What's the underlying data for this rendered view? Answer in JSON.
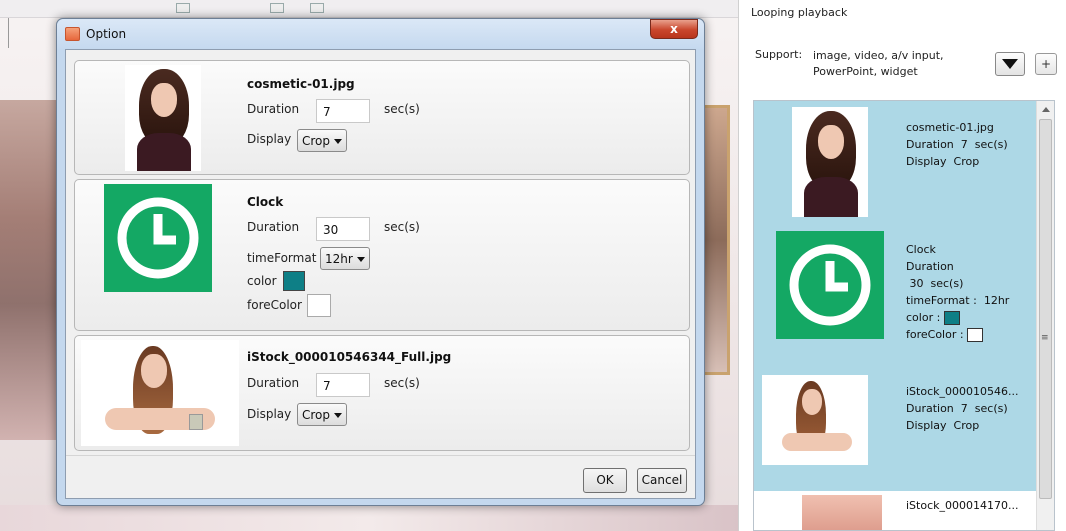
{
  "background": {
    "right_panel": {
      "title": "Looping playback",
      "support_label": "Support:",
      "support_value": "image, video, a/v input, PowerPoint, widget",
      "add_label": "+",
      "items": [
        {
          "name": "cosmetic-01.jpg",
          "duration_label": "Duration",
          "duration": "7",
          "unit": "sec(s)",
          "display_label": "Display",
          "display": "Crop"
        },
        {
          "name": "Clock",
          "duration_label": "Duration",
          "duration": "30",
          "unit": "sec(s)",
          "timeformat_label": "timeFormat :",
          "timeformat": "12hr",
          "color_label": "color :",
          "forecolor_label": "foreColor :"
        },
        {
          "name": "iStock_000010546...",
          "duration_label": "Duration",
          "duration": "7",
          "unit": "sec(s)",
          "display_label": "Display",
          "display": "Crop"
        },
        {
          "name": "iStock_000014170..."
        }
      ]
    }
  },
  "dialog": {
    "title": "Option",
    "close_label": "x",
    "cards": [
      {
        "filename": "cosmetic-01.jpg",
        "duration_label": "Duration",
        "duration": "7",
        "unit": "sec(s)",
        "display_label": "Display",
        "display": "Crop"
      },
      {
        "filename": "Clock",
        "duration_label": "Duration",
        "duration": "30",
        "unit": "sec(s)",
        "timeformat_label": "timeFormat",
        "timeformat": "12hr",
        "color_label": "color",
        "forecolor_label": "foreColor",
        "color_value": "#0e7f86",
        "forecolor_value": "#ffffff"
      },
      {
        "filename": "iStock_000010546344_Full.jpg",
        "duration_label": "Duration",
        "duration": "7",
        "unit": "sec(s)",
        "display_label": "Display",
        "display": "Crop"
      }
    ],
    "ok_label": "OK",
    "cancel_label": "Cancel"
  },
  "colors": {
    "accent_selected": "#add8e6",
    "clock_green": "#14a864",
    "close_red": "#c9462c"
  }
}
